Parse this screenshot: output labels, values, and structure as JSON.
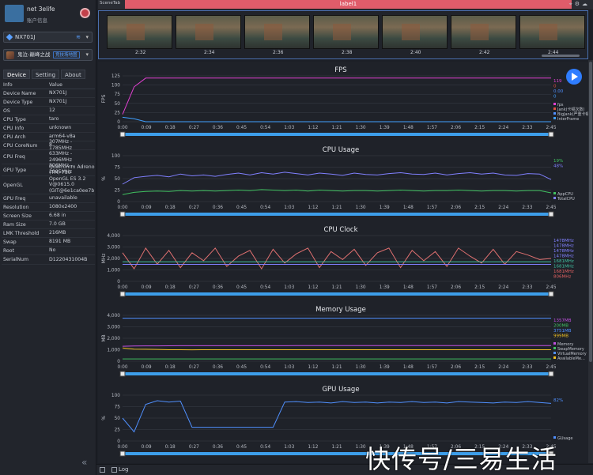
{
  "user": {
    "name": "net 3elife",
    "account": "账户信息"
  },
  "device": {
    "selected": "NX701J"
  },
  "app": {
    "name": "鬼泣-巅峰之战",
    "badge": "竞技场地图"
  },
  "tabs": [
    "Device",
    "Setting",
    "About"
  ],
  "device_info": {
    "headers": {
      "info": "Info",
      "value": "Value"
    },
    "rows": [
      {
        "k": "Device Name",
        "v": "NX701J"
      },
      {
        "k": "Device Type",
        "v": "NX701J"
      },
      {
        "k": "OS",
        "v": "12"
      },
      {
        "k": "CPU Type",
        "v": "taro"
      },
      {
        "k": "CPU Info",
        "v": "unknown"
      },
      {
        "k": "CPU Arch",
        "v": "arm64-v8a"
      },
      {
        "k": "CPU CoreNum",
        "v": "8"
      },
      {
        "k": "CPU Freq",
        "v": "307MHz - 1785MHz\n633MHz - 2496MHz\n806MHz - 2995MHz"
      },
      {
        "k": "GPU Type",
        "v": "Qualcomm Adreno\n(TM) 730"
      },
      {
        "k": "OpenGL",
        "v": "OpenGL ES 3.2\nV@0615.0\n(GIT@6e1ca0ee7b"
      },
      {
        "k": "GPU Freq",
        "v": "unavailable"
      },
      {
        "k": "Resolution",
        "v": "1080x2400"
      },
      {
        "k": "Screen Size",
        "v": "6.68 in"
      },
      {
        "k": "Ram Size",
        "v": "7.0 GB"
      },
      {
        "k": "LMK Threshold",
        "v": "216MB"
      },
      {
        "k": "Swap",
        "v": "8191 MB"
      },
      {
        "k": "Root",
        "v": "No"
      },
      {
        "k": "SerialNum",
        "v": "D1220431004B"
      }
    ]
  },
  "topbar": {
    "scene_tab": "SceneTab",
    "label": "label1"
  },
  "thumbnails": {
    "times": [
      "2:32",
      "2:34",
      "2:36",
      "2:38",
      "2:40",
      "2:42",
      "2:44"
    ]
  },
  "x_ticks": [
    "0:00",
    "0:09",
    "0:18",
    "0:27",
    "0:36",
    "0:45",
    "0:54",
    "1:03",
    "1:12",
    "1:21",
    "1:30",
    "1:39",
    "1:48",
    "1:57",
    "2:06",
    "2:15",
    "2:24",
    "2:33",
    "2:45"
  ],
  "bottom": {
    "log_label": "Log"
  },
  "watermark": "快传号/三易生活",
  "colors": {
    "accent": "#2f7dff",
    "label_bar": "#e05c6a"
  },
  "chart_data": [
    {
      "type": "line",
      "title": "FPS",
      "ylabel": "FPS",
      "ylim": [
        0,
        125
      ],
      "yticks": [
        "0",
        "25",
        "50",
        "75",
        "100",
        "125"
      ],
      "legend_values": [
        {
          "text": "119",
          "color": "#e040d0"
        },
        {
          "text": "0",
          "color": "#e05040"
        },
        {
          "text": "0.00",
          "color": "#5090ff"
        },
        {
          "text": "0",
          "color": "#40a0ff"
        }
      ],
      "legend": [
        {
          "label": "fps",
          "color": "#e040d0"
        },
        {
          "label": "Jank(卡顿次数)",
          "color": "#e05040"
        },
        {
          "label": "BigJank(严重卡顿)",
          "color": "#5090ff"
        },
        {
          "label": "InterFrame",
          "color": "#40a0ff"
        }
      ],
      "series": [
        {
          "name": "fps",
          "color": "#e040d0",
          "values": [
            20,
            95,
            119,
            119,
            119,
            119,
            119,
            119,
            119,
            119,
            119,
            119,
            119,
            119,
            119,
            119,
            119,
            119,
            119,
            119,
            119,
            119,
            119,
            119,
            119,
            119,
            119,
            119,
            119,
            119,
            119,
            119,
            119,
            119,
            119,
            119,
            119,
            119
          ]
        },
        {
          "name": "InterFrame",
          "color": "#40a0ff",
          "values": [
            12,
            8,
            0,
            0,
            0,
            0,
            0,
            0,
            0,
            0,
            0,
            0,
            0,
            0,
            0,
            0,
            0,
            0,
            0,
            0,
            0,
            0,
            0,
            0,
            0,
            0,
            0,
            0,
            0,
            0,
            0,
            0,
            0,
            0,
            0,
            0,
            0,
            0
          ]
        }
      ]
    },
    {
      "type": "line",
      "title": "CPU Usage",
      "ylabel": "%",
      "ylim": [
        0,
        100
      ],
      "yticks": [
        "0",
        "25",
        "50",
        "75",
        "100"
      ],
      "legend_values": [
        {
          "text": "19%",
          "color": "#40c060"
        },
        {
          "text": "48%",
          "color": "#8080ff"
        }
      ],
      "legend": [
        {
          "label": "AppCPU",
          "color": "#40c060"
        },
        {
          "label": "TotalCPU",
          "color": "#8080ff"
        }
      ],
      "series": [
        {
          "name": "TotalCPU",
          "color": "#8080ff",
          "values": [
            38,
            52,
            55,
            57,
            54,
            60,
            56,
            58,
            55,
            59,
            62,
            58,
            63,
            60,
            64,
            61,
            58,
            62,
            60,
            57,
            62,
            59,
            58,
            61,
            63,
            60,
            59,
            62,
            58,
            61,
            63,
            60,
            62,
            58,
            57,
            61,
            60,
            48
          ]
        },
        {
          "name": "AppCPU",
          "color": "#40c060",
          "values": [
            15,
            20,
            22,
            23,
            22,
            24,
            23,
            24,
            23,
            24,
            25,
            24,
            26,
            25,
            24,
            25,
            23,
            25,
            24,
            23,
            24,
            24,
            23,
            24,
            25,
            24,
            23,
            24,
            24,
            25,
            24,
            23,
            24,
            24,
            23,
            24,
            24,
            19
          ]
        }
      ]
    },
    {
      "type": "line",
      "title": "CPU Clock",
      "ylabel": "MHz",
      "ylim": [
        0,
        4000
      ],
      "yticks": [
        "0",
        "1,000",
        "2,000",
        "3,000",
        "4,000"
      ],
      "legend_values": [
        {
          "text": "1478MHz",
          "color": "#8080ff"
        },
        {
          "text": "1478MHz",
          "color": "#8080ff"
        },
        {
          "text": "1478MHz",
          "color": "#8080ff"
        },
        {
          "text": "1478MHz",
          "color": "#8080ff"
        },
        {
          "text": "1681MHz",
          "color": "#40c0a0"
        },
        {
          "text": "1681MHz",
          "color": "#40c0a0"
        },
        {
          "text": "1681MHz",
          "color": "#e06060"
        },
        {
          "text": "806MHz",
          "color": "#e06060"
        }
      ],
      "series": [
        {
          "name": "big",
          "color": "#e07070",
          "values": [
            2500,
            1100,
            2900,
            1500,
            2700,
            1200,
            2500,
            1800,
            2900,
            1300,
            2200,
            2700,
            1100,
            2800,
            1600,
            2400,
            2900,
            1200,
            2600,
            1900,
            2800,
            1400,
            2500,
            2900,
            1200,
            2700,
            1800,
            2600,
            1300,
            2900,
            2200,
            1600,
            2800,
            1500,
            2600,
            2300,
            1900,
            2000
          ]
        },
        {
          "name": "mid",
          "color": "#40c0a0",
          "values": [
            1700,
            1700,
            1700,
            1700,
            1700,
            1700,
            1700,
            1700,
            1700,
            1700,
            1700,
            1700,
            1700,
            1700,
            1700,
            1700,
            1700,
            1700,
            1700,
            1700,
            1700,
            1700,
            1700,
            1700,
            1700,
            1700,
            1700,
            1700,
            1700,
            1700,
            1700,
            1700,
            1700,
            1700,
            1700,
            1700,
            1700,
            1700
          ]
        },
        {
          "name": "little",
          "color": "#8080ff",
          "values": [
            1480,
            1480,
            1480,
            1480,
            1480,
            1480,
            1480,
            1480,
            1480,
            1480,
            1480,
            1480,
            1480,
            1480,
            1480,
            1480,
            1480,
            1480,
            1480,
            1480,
            1480,
            1480,
            1480,
            1480,
            1480,
            1480,
            1480,
            1480,
            1480,
            1480,
            1480,
            1480,
            1480,
            1480,
            1480,
            1480,
            1480,
            1480
          ]
        }
      ]
    },
    {
      "type": "line",
      "title": "Memory Usage",
      "ylabel": "MB",
      "ylim": [
        0,
        4000
      ],
      "yticks": [
        "0",
        "1,000",
        "2,000",
        "3,000",
        "4,000"
      ],
      "legend_values": [
        {
          "text": "1357MB",
          "color": "#c050e0"
        },
        {
          "text": "200MB",
          "color": "#40c060"
        },
        {
          "text": "3751MB",
          "color": "#5090ff"
        },
        {
          "text": "999MB",
          "color": "#f0c020"
        }
      ],
      "legend": [
        {
          "label": "Memory",
          "color": "#c050e0"
        },
        {
          "label": "SwapMemory",
          "color": "#40c060"
        },
        {
          "label": "VirtualMemory",
          "color": "#5090ff"
        },
        {
          "label": "AvailableMe...",
          "color": "#f0c020"
        }
      ],
      "series": [
        {
          "name": "VirtualMemory",
          "color": "#5090ff",
          "values": [
            3750,
            3750,
            3750,
            3750,
            3750,
            3750,
            3750,
            3750,
            3750,
            3750,
            3750,
            3750,
            3750,
            3750,
            3750,
            3750,
            3750,
            3750,
            3750,
            3750,
            3750,
            3750,
            3750,
            3750,
            3750,
            3750,
            3750,
            3750,
            3750,
            3750,
            3750,
            3750,
            3750,
            3750,
            3750,
            3750,
            3750,
            3750
          ]
        },
        {
          "name": "Memory",
          "color": "#c050e0",
          "values": [
            1300,
            1330,
            1340,
            1340,
            1345,
            1350,
            1350,
            1350,
            1352,
            1352,
            1353,
            1354,
            1355,
            1355,
            1355,
            1356,
            1356,
            1356,
            1357,
            1357,
            1357,
            1357,
            1357,
            1357,
            1357,
            1357,
            1357,
            1357,
            1357,
            1357,
            1357,
            1357,
            1357,
            1357,
            1357,
            1357,
            1357,
            1357
          ]
        },
        {
          "name": "AvailableMemory",
          "color": "#f0c020",
          "values": [
            1150,
            1050,
            1040,
            1030,
            1000,
            1000,
            990,
            1000,
            1000,
            1000,
            1000,
            1000,
            1000,
            1000,
            1000,
            1000,
            1000,
            1000,
            1000,
            1000,
            1000,
            1000,
            1000,
            1000,
            1000,
            1000,
            1000,
            1000,
            1000,
            1000,
            1000,
            1000,
            1000,
            1000,
            1000,
            1000,
            1000,
            999
          ]
        },
        {
          "name": "SwapMemory",
          "color": "#40c060",
          "values": [
            200,
            200,
            200,
            200,
            200,
            200,
            200,
            200,
            200,
            200,
            200,
            200,
            200,
            200,
            200,
            200,
            200,
            200,
            200,
            200,
            200,
            200,
            200,
            200,
            200,
            200,
            200,
            200,
            200,
            200,
            200,
            200,
            200,
            200,
            200,
            200,
            200,
            200
          ]
        }
      ]
    },
    {
      "type": "line",
      "title": "GPU Usage",
      "ylabel": "%",
      "ylim": [
        0,
        100
      ],
      "yticks": [
        "0",
        "25",
        "50",
        "75",
        "100"
      ],
      "legend_values": [
        {
          "text": "82%",
          "color": "#5090ff"
        }
      ],
      "legend": [
        {
          "label": "GUsage",
          "color": "#5090ff"
        }
      ],
      "series": [
        {
          "name": "GUsage",
          "color": "#5090ff",
          "values": [
            50,
            20,
            80,
            88,
            85,
            87,
            30,
            30,
            30,
            30,
            30,
            30,
            30,
            30,
            85,
            86,
            84,
            85,
            83,
            86,
            84,
            85,
            83,
            85,
            84,
            86,
            84,
            85,
            83,
            86,
            85,
            84,
            83,
            85,
            84,
            86,
            84,
            82
          ]
        }
      ]
    }
  ]
}
